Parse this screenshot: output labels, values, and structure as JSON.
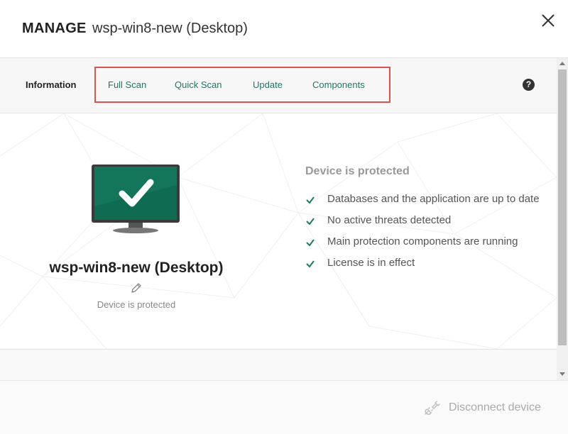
{
  "header": {
    "manage_label": "MANAGE",
    "device_title": "wsp-win8-new (Desktop)",
    "close_icon": "close-icon"
  },
  "tabs": {
    "active": "Information",
    "items": [
      {
        "label": "Full Scan"
      },
      {
        "label": "Quick Scan"
      },
      {
        "label": "Update"
      },
      {
        "label": "Components"
      }
    ],
    "help_glyph": "?"
  },
  "device": {
    "name": "wsp-win8-new (Desktop)",
    "status": "Device is protected"
  },
  "protection": {
    "title": "Device is protected",
    "items": [
      {
        "text": "Databases and the application are up to date"
      },
      {
        "text": "No active threats detected"
      },
      {
        "text": "Main protection components are running"
      },
      {
        "text": "License is in effect"
      }
    ]
  },
  "footer": {
    "disconnect_label": "Disconnect device"
  },
  "colors": {
    "accent_green": "#1a7a63",
    "screen_green": "#0f6b52",
    "highlight_red": "#d9534f"
  }
}
